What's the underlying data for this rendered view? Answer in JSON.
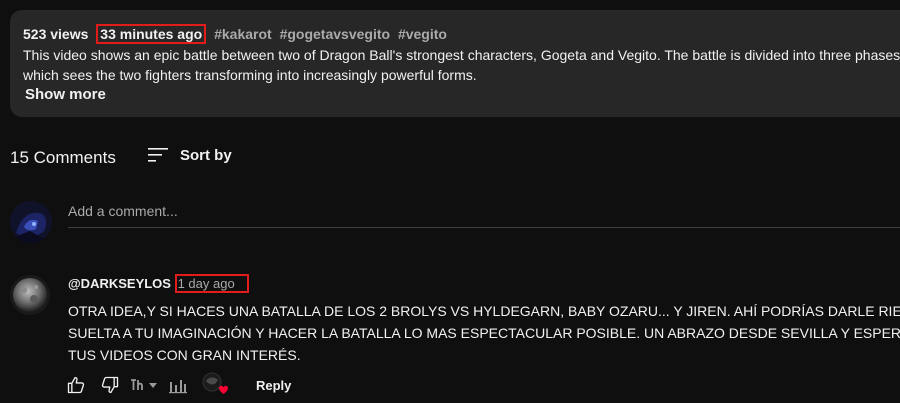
{
  "description": {
    "views": "523 views",
    "time": "33 minutes ago",
    "hashtags": [
      "#kakarot",
      "#gogetavsvegito",
      "#vegito"
    ],
    "lines": [
      "This video shows an epic battle between two of Dragon Ball's strongest characters, Gogeta and Vegito. The battle is divided into three phases, each one",
      "which sees the two fighters transforming into increasingly powerful forms."
    ],
    "show_more": "Show more"
  },
  "comments_header": {
    "count": "15 Comments",
    "sort_label": "Sort by"
  },
  "add_comment": {
    "placeholder": "Add a comment..."
  },
  "comment": {
    "author": "@DARKSEYLOS",
    "time": "1 day ago",
    "lines": [
      "OTRA IDEA,Y SI HACES UNA BATALLA DE LOS 2 BROLYS VS HYLDEGARN, BABY OZARU... Y JIREN. AHÍ PODRÍAS DARLE RIENDA",
      "SUELTA A TU IMAGINACIÓN Y HACER LA BATALLA LO MAS ESPECTACULAR POSIBLE. UN ABRAZO DESDE SEVILLA Y ESPERO",
      "TUS VIDEOS CON GRAN INTERÉS."
    ],
    "reply_label": "Reply",
    "like_icon": "thumb-up-icon",
    "dislike_icon": "thumb-down-icon"
  },
  "colors": {
    "background": "#0f0f0f",
    "panel": "#272727",
    "highlight_box": "#e21b1b",
    "secondary_text": "#aaaaaa"
  }
}
